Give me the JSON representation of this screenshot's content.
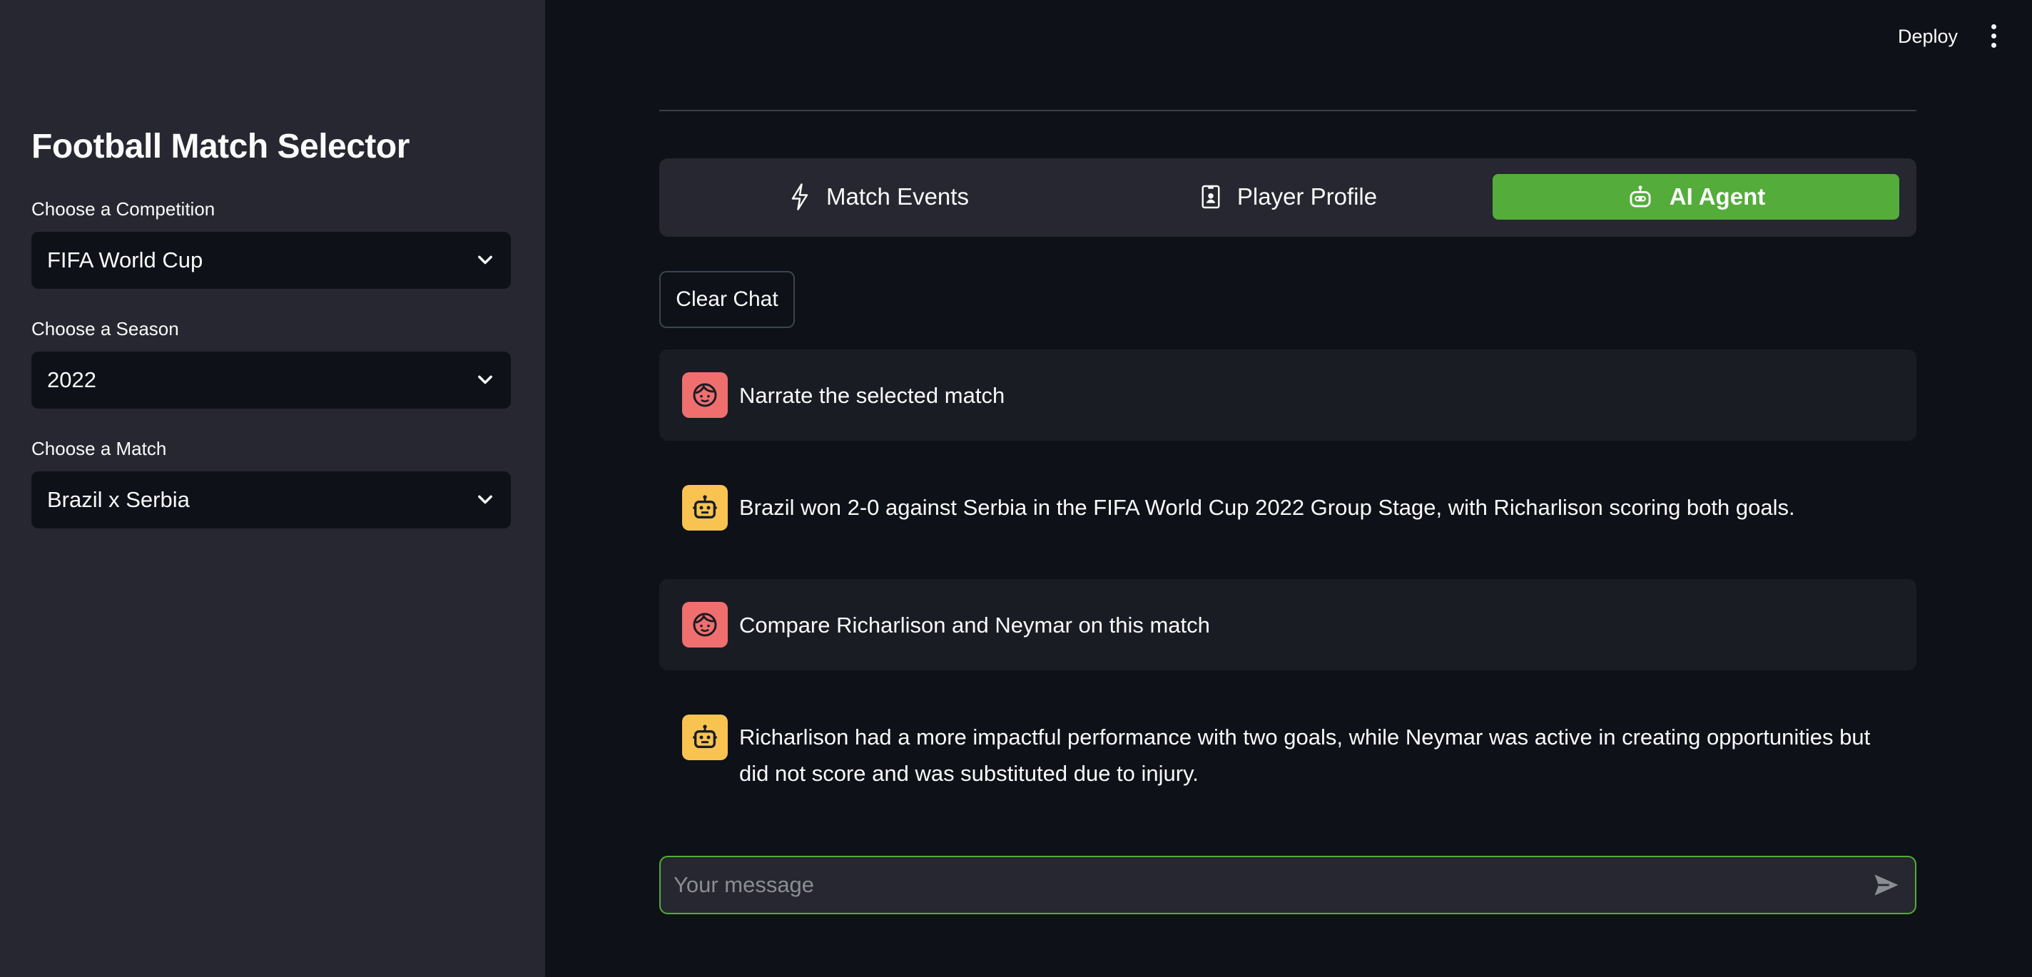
{
  "header": {
    "deploy_label": "Deploy",
    "menu_icon": "kebab-menu-icon"
  },
  "sidebar": {
    "title": "Football Match Selector",
    "competition": {
      "label": "Choose a Competition",
      "value": "FIFA World Cup"
    },
    "season": {
      "label": "Choose a Season",
      "value": "2022"
    },
    "match": {
      "label": "Choose a Match",
      "value": "Brazil x Serbia"
    }
  },
  "tabs": [
    {
      "label": "Match Events",
      "icon": "lightning-icon",
      "active": false
    },
    {
      "label": "Player Profile",
      "icon": "id-badge-icon",
      "active": false
    },
    {
      "label": "AI Agent",
      "icon": "robot-icon",
      "active": true
    }
  ],
  "clear_chat_label": "Clear Chat",
  "messages": [
    {
      "role": "user",
      "text": "Narrate the selected match"
    },
    {
      "role": "assistant",
      "text": "Brazil won 2-0 against Serbia in the FIFA World Cup 2022 Group Stage, with Richarlison scoring both goals."
    },
    {
      "role": "user",
      "text": "Compare Richarlison and Neymar on this match"
    },
    {
      "role": "assistant",
      "text": "Richarlison had a more impactful performance with two goals, while Neymar was active in creating opportunities but did not score and was substituted due to injury."
    }
  ],
  "chat_input": {
    "placeholder": "Your message",
    "value": ""
  },
  "colors": {
    "accent": "#54ac3a",
    "sidebar_bg": "#262730",
    "main_bg": "#0e1117",
    "user_avatar": "#ef6f6f",
    "bot_avatar": "#f8c350"
  }
}
